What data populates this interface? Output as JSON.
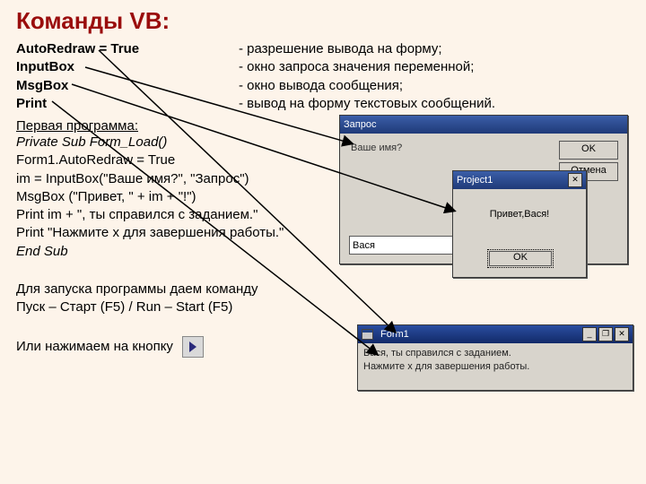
{
  "heading": "Команды VB:",
  "cmds": [
    "AutoRedraw = True",
    "InputBox",
    "MsgBox",
    "Print"
  ],
  "cmds_desc": [
    "- разрешение вывода на форму;",
    "- окно запроса значения переменной;",
    "- окно вывода сообщения;",
    "- вывод на форму текстовых сообщений."
  ],
  "sections": {
    "first_program": "Первая программа:",
    "code": [
      "Private Sub Form_Load()",
      "Form1.AutoRedraw = True",
      "im = InputBox(\"Ваше имя?\", \"Запрос\")",
      "MsgBox (\"Привет, \" + im + \"!\")",
      "Print im + \", ты справился с заданием.\"",
      "Print \"Нажмите x для завершения работы.\"",
      "End Sub"
    ],
    "run_line1": "Для запуска программы даем команду",
    "run_line2": "Пуск – Старт (F5) / Run – Start (F5)",
    "or_press": "Или нажимаем на кнопку"
  },
  "windows": {
    "input": {
      "title": "Запрос",
      "label": "Ваше имя?",
      "field_value": "Вася",
      "ok": "OK",
      "cancel": "Отмена"
    },
    "msgbox": {
      "title": "Project1",
      "close": "✕",
      "text": "Привет,Вася!",
      "ok": "OK"
    },
    "form": {
      "title": "Form1",
      "minimize": "_",
      "restore": "❐",
      "close": "✕",
      "line1": "Вася, ты справился с заданием.",
      "line2": "Нажмите x для завершения работы."
    }
  }
}
